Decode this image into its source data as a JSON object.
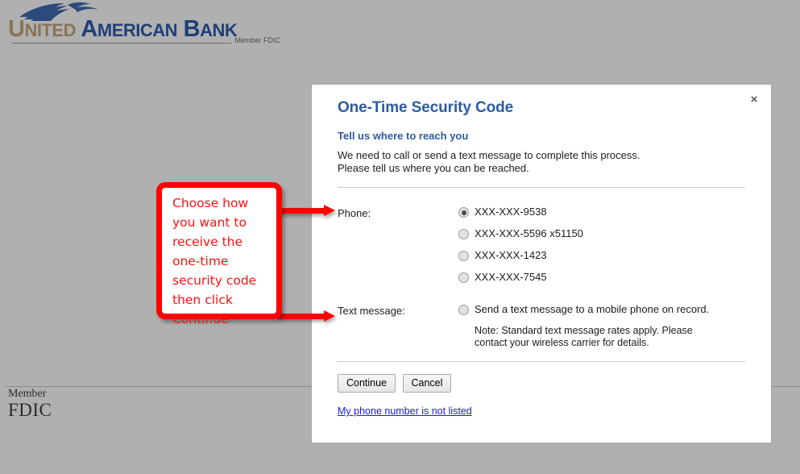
{
  "page": {
    "background_color": "#b0b0b0"
  },
  "header": {
    "logo": {
      "word_united": "UNITED",
      "word_american": "AMERICAN",
      "word_bank": "BANK",
      "tagline": "Member FDIC",
      "united_color": "#8a7454",
      "blue_color": "#1f3f7a",
      "eagle_icon": "eagle-wing-icon"
    }
  },
  "footer": {
    "member": "Member",
    "fdic": "FDIC"
  },
  "dialog": {
    "title": "One-Time Security Code",
    "close_label": "×",
    "subtitle": "Tell us where to reach you",
    "intro_line1": "We need to call or send a text message to complete this process.",
    "intro_line2": "Please tell us where you can be reached.",
    "phone": {
      "label": "Phone:",
      "options": [
        {
          "value": "XXX-XXX-9538",
          "selected": true
        },
        {
          "value": "XXX-XXX-5596 x51150",
          "selected": false
        },
        {
          "value": "XXX-XXX-1423",
          "selected": false
        },
        {
          "value": "XXX-XXX-7545",
          "selected": false
        }
      ]
    },
    "sms": {
      "label": "Text message:",
      "option": "Send a text message to a mobile phone on record.",
      "selected": false,
      "note_line1": "Note: Standard text message rates apply. Please",
      "note_line2": "contact your wireless carrier for details."
    },
    "actions": {
      "continue_label": "Continue",
      "cancel_label": "Cancel"
    },
    "alt_link": "My phone number is not listed",
    "link_color": "#1a1ad6",
    "accent_color": "#2b5ba3"
  },
  "annotation": {
    "text": "Choose how\nyou want to\nreceive the\none-time\nsecurity code\nthen click\nContinue",
    "color": "#ff0000"
  }
}
